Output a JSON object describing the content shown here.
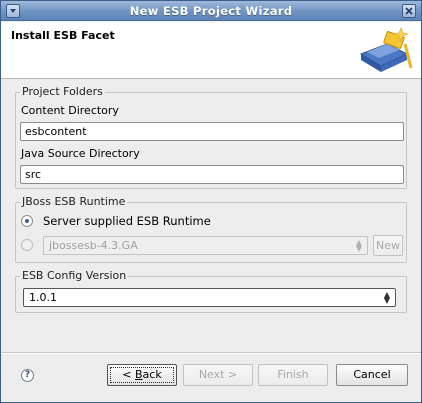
{
  "window": {
    "title": "New ESB Project Wizard"
  },
  "header": {
    "title": "Install ESB Facet",
    "image_icon": "wizard-banner-icon"
  },
  "project_folders": {
    "legend": "Project Folders",
    "content_dir_label": "Content Directory",
    "content_dir_value": "esbcontent",
    "java_src_label": "Java Source Directory",
    "java_src_value": "src"
  },
  "runtime": {
    "legend": "JBoss ESB Runtime",
    "server_supplied_label": "Server supplied ESB Runtime",
    "runtime_select_value": "jbossesb-4.3.GA",
    "new_button": "New"
  },
  "config_version": {
    "legend": "ESB Config Version",
    "selected": "1.0.1"
  },
  "buttons": {
    "back_prefix": "< ",
    "back_accel": "B",
    "back_rest": "ack",
    "next": "Next >",
    "finish": "Finish",
    "cancel": "Cancel"
  },
  "colors": {
    "titlebar": "#6f93c2",
    "dialog_bg": "#ededed",
    "radio_accent": "#3b5f8c"
  }
}
